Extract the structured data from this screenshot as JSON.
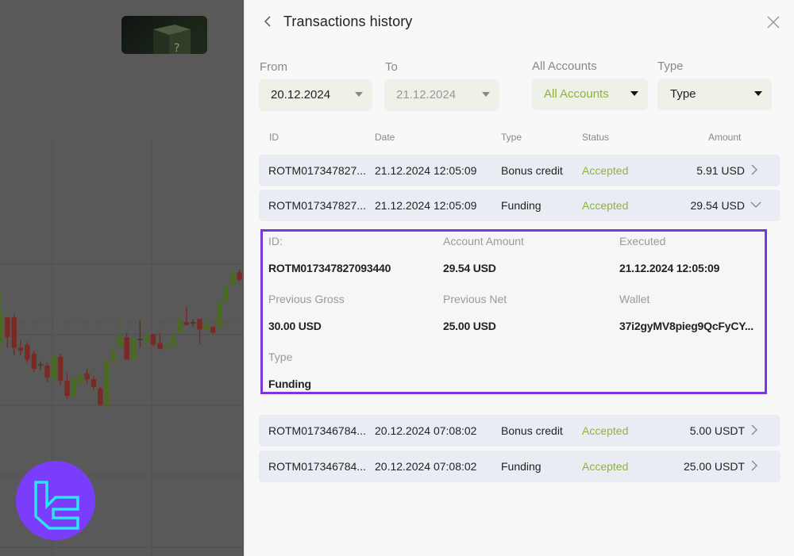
{
  "background_chart": {
    "candles": [
      {
        "o": 60,
        "c": 42,
        "h": 75,
        "l": 35,
        "dir": "up"
      },
      {
        "o": 45,
        "c": 58,
        "h": 58,
        "l": 38,
        "dir": "down"
      },
      {
        "o": 58,
        "c": 38,
        "h": 60,
        "l": 33,
        "dir": "down"
      },
      {
        "o": 38,
        "c": 36,
        "h": 43,
        "l": 33,
        "dir": "down"
      },
      {
        "o": 40,
        "c": 30,
        "h": 42,
        "l": 28,
        "dir": "down"
      },
      {
        "o": 34,
        "c": 24,
        "h": 36,
        "l": 22,
        "dir": "down"
      },
      {
        "o": 27,
        "c": 26,
        "h": 29,
        "l": 23,
        "dir": "doji"
      },
      {
        "o": 26,
        "c": 18,
        "h": 28,
        "l": 15,
        "dir": "down"
      },
      {
        "o": 18,
        "c": 32,
        "h": 34,
        "l": 15,
        "dir": "up"
      },
      {
        "o": 32,
        "c": 16,
        "h": 34,
        "l": 13,
        "dir": "down"
      },
      {
        "o": 16,
        "c": 6,
        "h": 21,
        "l": 4,
        "dir": "down"
      },
      {
        "o": 6,
        "c": 17,
        "h": 19,
        "l": 6,
        "dir": "up"
      },
      {
        "o": 14,
        "c": 20,
        "h": 22,
        "l": 12,
        "dir": "up"
      },
      {
        "o": 21,
        "c": 17,
        "h": 24,
        "l": 14,
        "dir": "down"
      },
      {
        "o": 17,
        "c": 12,
        "h": 19,
        "l": 10,
        "dir": "down"
      },
      {
        "o": 11,
        "c": 0,
        "h": 12,
        "l": -1,
        "dir": "down"
      },
      {
        "o": 0,
        "c": 29,
        "h": 30,
        "l": -3,
        "dir": "up"
      },
      {
        "o": 29,
        "c": 35,
        "h": 39,
        "l": 29,
        "dir": "up"
      },
      {
        "o": 38,
        "c": 46,
        "h": 58,
        "l": 37,
        "dir": "up"
      },
      {
        "o": 45,
        "c": 30,
        "h": 48,
        "l": 30,
        "dir": "down"
      },
      {
        "o": 30,
        "c": 44,
        "h": 45,
        "l": 30,
        "dir": "up"
      },
      {
        "o": 44,
        "c": 44,
        "h": 56,
        "l": 38,
        "dir": "doji"
      },
      {
        "o": 42,
        "c": 46,
        "h": 48,
        "l": 40,
        "dir": "up"
      },
      {
        "o": 47,
        "c": 40,
        "h": 47,
        "l": 39,
        "dir": "down"
      },
      {
        "o": 41,
        "c": 37,
        "h": 48,
        "l": 37,
        "dir": "down"
      },
      {
        "o": 38,
        "c": 40,
        "h": 41,
        "l": 37,
        "dir": "up"
      },
      {
        "o": 39,
        "c": 46,
        "h": 46,
        "l": 38,
        "dir": "up"
      },
      {
        "o": 48,
        "c": 56,
        "h": 59,
        "l": 48,
        "dir": "up"
      },
      {
        "o": 55,
        "c": 53,
        "h": 65,
        "l": 53,
        "dir": "down"
      },
      {
        "o": 55,
        "c": 54,
        "h": 57,
        "l": 52,
        "dir": "doji"
      },
      {
        "o": 57,
        "c": 50,
        "h": 57,
        "l": 40,
        "dir": "down"
      },
      {
        "o": 50,
        "c": 53,
        "h": 58,
        "l": 50,
        "dir": "up"
      },
      {
        "o": 52,
        "c": 48,
        "h": 52,
        "l": 47,
        "dir": "down"
      },
      {
        "o": 51,
        "c": 68,
        "h": 70,
        "l": 51,
        "dir": "up"
      },
      {
        "o": 69,
        "c": 78,
        "h": 80,
        "l": 67,
        "dir": "up"
      },
      {
        "o": 80,
        "c": 88,
        "h": 90,
        "l": 78,
        "dir": "up"
      },
      {
        "o": 88,
        "c": 83,
        "h": 90,
        "l": 82,
        "dir": "down"
      }
    ],
    "reference_level": 54
  },
  "mystery_box": {
    "glyph": "?"
  },
  "logo": {
    "name": "tradingfinder-logo"
  },
  "panel": {
    "back_icon": "chevron-left-icon",
    "title": "Transactions history",
    "close_icon": "close-icon"
  },
  "filters": {
    "from": {
      "label": "From",
      "value": "20.12.2024"
    },
    "to": {
      "label": "To",
      "value": "21.12.2024"
    },
    "accounts": {
      "label": "All Accounts",
      "value": "All Accounts"
    },
    "type": {
      "label": "Type",
      "value": "Type"
    }
  },
  "table": {
    "columns": [
      "ID",
      "Date",
      "Type",
      "Status",
      "Amount"
    ],
    "rows": [
      {
        "id": "ROTM017347827...",
        "date": "21.12.2024 12:05:09",
        "type": "Bonus credit",
        "status": "Accepted",
        "amount": "5.91 USD",
        "expanded": false
      },
      {
        "id": "ROTM017347827...",
        "date": "21.12.2024 12:05:09",
        "type": "Funding",
        "status": "Accepted",
        "amount": "29.54 USD",
        "expanded": true
      },
      {
        "id": "ROTM017346784...",
        "date": "20.12.2024 07:08:02",
        "type": "Bonus credit",
        "status": "Accepted",
        "amount": "5.00 USDT",
        "expanded": false
      },
      {
        "id": "ROTM017346784...",
        "date": "20.12.2024 07:08:02",
        "type": "Funding",
        "status": "Accepted",
        "amount": "25.00 USDT",
        "expanded": false
      }
    ]
  },
  "detail": {
    "id_label": "ID:",
    "id_value": "ROTM017347827093440",
    "account_amount_label": "Account Amount",
    "account_amount_value": "29.54 USD",
    "executed_label": "Executed",
    "executed_value": "21.12.2024 12:05:09",
    "prev_gross_label": "Previous Gross",
    "prev_gross_value": "30.00 USD",
    "prev_net_label": "Previous Net",
    "prev_net_value": "25.00 USD",
    "wallet_label": "Wallet",
    "wallet_value": "37i2gyMV8pieg9QcFyCY...",
    "type_label": "Type",
    "type_value": "Funding"
  },
  "colors": {
    "accent_green": "#8db43a",
    "highlight_border": "#7c38d6",
    "row_bg": "#e9edf3",
    "filter_bg": "#eef1e8",
    "candle_up": "#4a6a22",
    "candle_down": "#7a2a22",
    "logo_bg": "#7b3dfc",
    "logo_fg": "#2de3f5"
  }
}
